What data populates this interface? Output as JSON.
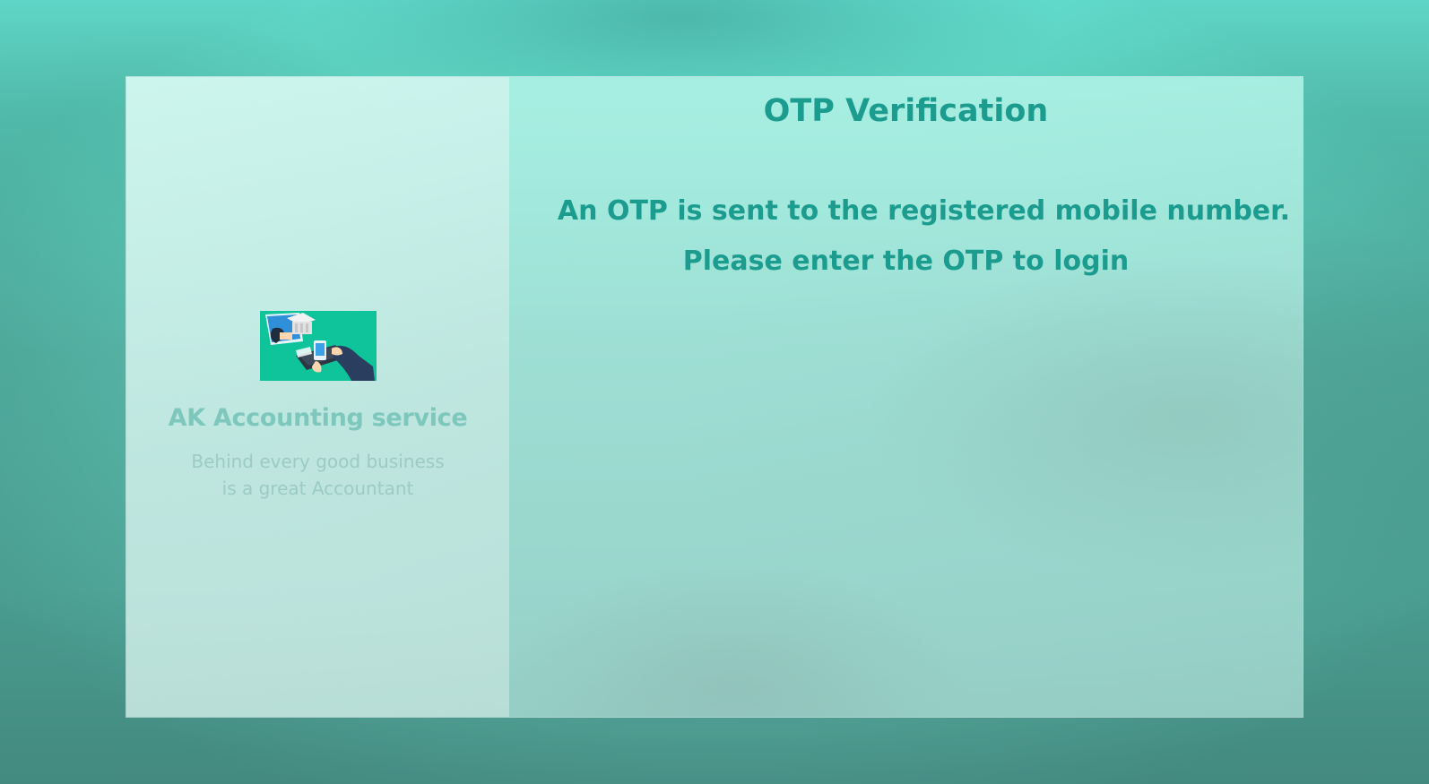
{
  "brand": {
    "title": "AK Accounting service",
    "tagline_line1": "Behind every good business",
    "tagline_line2": "is a great Accountant",
    "logo_icon": "accounting-illustration-icon"
  },
  "otp": {
    "title": "OTP Verification",
    "message_line1": "An OTP is sent to the registered mobile number.",
    "message_line2": "Please enter the OTP to login"
  },
  "colors": {
    "accent": "#1c9c8f",
    "brand_text": "#7dc7bd",
    "tagline_text": "#9ccac4",
    "logo_bg": "#0fc39a"
  }
}
